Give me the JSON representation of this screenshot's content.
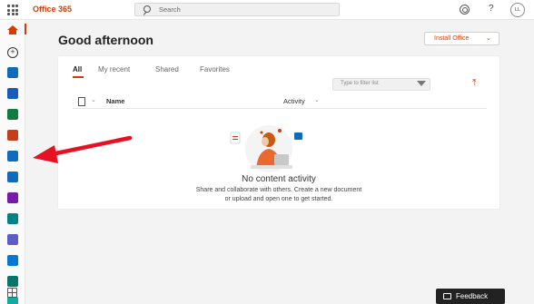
{
  "topbar": {
    "brand": "Office 365",
    "search_placeholder": "Search",
    "help": "?",
    "avatar_initials": "LL"
  },
  "main": {
    "greeting": "Good afternoon",
    "install_button": "Install Office",
    "tabs": [
      {
        "label": "All",
        "active": true
      },
      {
        "label": "My recent",
        "active": false
      },
      {
        "label": "Shared",
        "active": false
      },
      {
        "label": "Favorites",
        "active": false
      }
    ],
    "filter_placeholder": "Type to filter list",
    "columns": {
      "name": "Name",
      "activity": "Activity"
    },
    "empty": {
      "title": "No content activity",
      "line1": "Share and collaborate with others. Create a new document",
      "line2": "or upload and open one to get started."
    }
  },
  "feedback_label": "Feedback",
  "rail_apps": [
    {
      "icon": "outlook-icon",
      "color": "#0f6cbd"
    },
    {
      "icon": "word-icon",
      "color": "#185abd"
    },
    {
      "icon": "excel-icon",
      "color": "#107c41"
    },
    {
      "icon": "powerpoint-icon",
      "color": "#c43e1c"
    },
    {
      "icon": "outlook-icon",
      "color": "#0f6cbd"
    },
    {
      "icon": "onedrive-icon",
      "color": "#0f6cbd"
    },
    {
      "icon": "onenote-icon",
      "color": "#7719aa"
    },
    {
      "icon": "sharepoint-icon",
      "color": "#038387"
    },
    {
      "icon": "teams-icon",
      "color": "#5b5fc7"
    },
    {
      "icon": "sway-icon",
      "color": "#0078d4"
    },
    {
      "icon": "forms-icon",
      "color": "#077568"
    },
    {
      "icon": "planner-icon",
      "color": "#16a9a2"
    }
  ],
  "colors": {
    "accent": "#d83b01",
    "annotation_arrow": "#e81123"
  }
}
